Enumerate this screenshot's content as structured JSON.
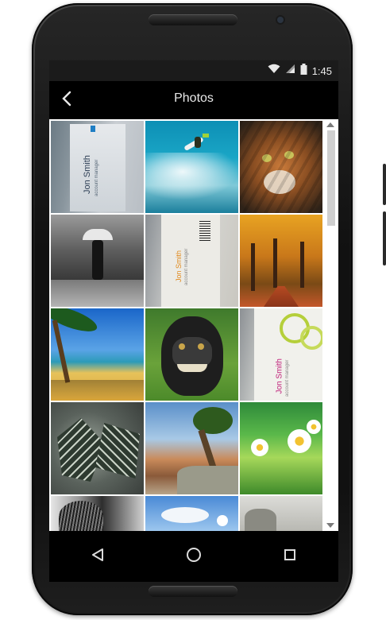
{
  "status_bar": {
    "time": "1:45",
    "icons": [
      "wifi-icon",
      "signal-icon",
      "battery-icon"
    ]
  },
  "app_bar": {
    "title": "Photos",
    "back_icon": "back-arrow-icon"
  },
  "photos": [
    {
      "subject": "business-card",
      "card_name": "Jon Smith",
      "card_role": "account manager"
    },
    {
      "subject": "surfer"
    },
    {
      "subject": "wild-cat"
    },
    {
      "subject": "woman-umbrella-rain"
    },
    {
      "subject": "business-card",
      "card_name": "Jon Smith",
      "card_role": "account manager"
    },
    {
      "subject": "autumn-park"
    },
    {
      "subject": "tropical-beach"
    },
    {
      "subject": "monkey-selfie"
    },
    {
      "subject": "business-card",
      "card_name": "Jon Smith",
      "card_role": "account manager"
    },
    {
      "subject": "succulent-plant"
    },
    {
      "subject": "tree-canyon"
    },
    {
      "subject": "daisies"
    },
    {
      "subject": "dog-bw"
    },
    {
      "subject": "flowers-sky"
    },
    {
      "subject": "grey-landscape"
    }
  ],
  "nav_bar": {
    "buttons": [
      "back-triangle-icon",
      "home-circle-icon",
      "recents-square-icon"
    ]
  },
  "colors": {
    "accent": "#1f7ec4",
    "card_pink": "#c0207a",
    "card_orange": "#e08a1e"
  }
}
